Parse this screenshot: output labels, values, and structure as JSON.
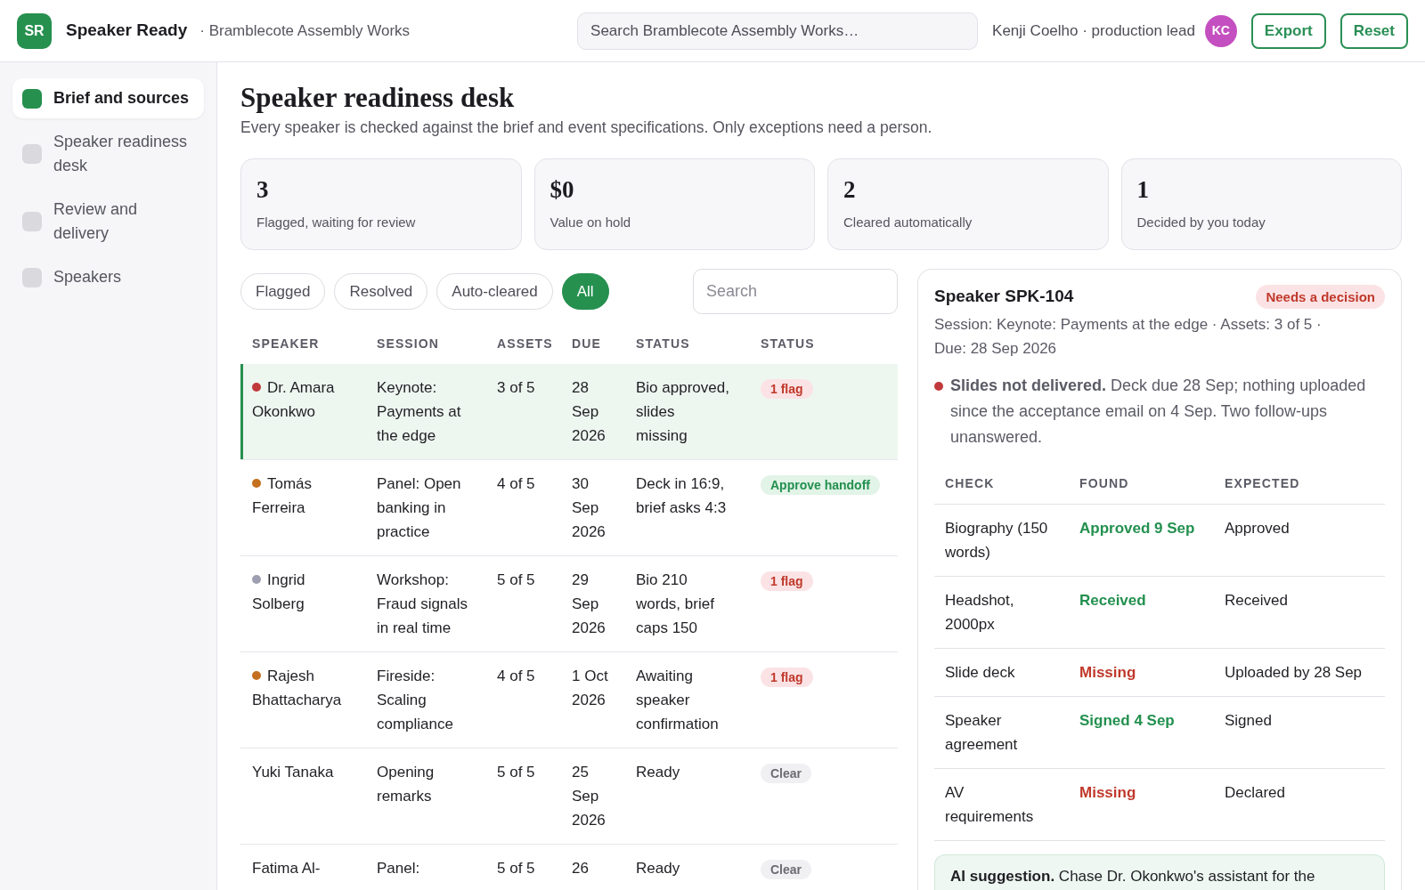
{
  "header": {
    "logo": "SR",
    "app_name": "Speaker Ready",
    "workspace": "· Bramblecote Assembly Works",
    "search": {
      "placeholder": "Search Bramblecote Assembly Works…"
    },
    "user": "Kenji Coelho · production lead",
    "avatar": "KC",
    "buttons": [
      "Export",
      "Reset"
    ]
  },
  "sidebar": {
    "items": [
      {
        "label": "Brief and sources",
        "selected": true
      },
      {
        "label": "Speaker readiness desk",
        "selected": false
      },
      {
        "label": "Review and delivery",
        "selected": false
      },
      {
        "label": "Speakers",
        "selected": false
      }
    ]
  },
  "page": {
    "title": "Speaker readiness desk",
    "subtitle": "Every speaker is checked against the brief and event specifications. Only exceptions need a person."
  },
  "stats": [
    {
      "value": "3",
      "label": "Flagged, waiting for review"
    },
    {
      "value": "$0",
      "label": "Value on hold"
    },
    {
      "value": "2",
      "label": "Cleared automatically"
    },
    {
      "value": "1",
      "label": "Decided by you today"
    }
  ],
  "filters": {
    "chips": [
      {
        "label": "Flagged",
        "selected": false
      },
      {
        "label": "Resolved",
        "selected": false
      },
      {
        "label": "Auto-cleared",
        "selected": false
      },
      {
        "label": "All",
        "selected": true
      }
    ],
    "search": {
      "placeholder": "Search"
    }
  },
  "table": {
    "columns": [
      "SPEAKER",
      "SESSION",
      "ASSETS",
      "DUE",
      "STATUS",
      "STATUS"
    ],
    "rows": [
      {
        "speaker": "Dr. Amara Okonkwo",
        "color": "#c0393b",
        "session": "Keynote: Payments at the edge",
        "assets": "3 of 5",
        "due": "28 Sep 2026",
        "status": "Bio approved, slides missing",
        "badge": {
          "kind": "flag",
          "label": "1 flag"
        },
        "selected": true
      },
      {
        "speaker": "Tomás Ferreira",
        "color": "#c4701f",
        "session": "Panel: Open banking in practice",
        "assets": "4 of 5",
        "due": "30 Sep 2026",
        "status": "Deck in 16:9, brief asks 4:3",
        "badge": {
          "kind": "approve",
          "label": "Approve handoff"
        },
        "selected": false
      },
      {
        "speaker": "Ingrid Solberg",
        "color": "#9e9eb0",
        "session": "Workshop: Fraud signals in real time",
        "assets": "5 of 5",
        "due": "29 Sep 2026",
        "status": "Bio 210 words, brief caps 150",
        "badge": {
          "kind": "flag",
          "label": "1 flag"
        },
        "selected": false
      },
      {
        "speaker": "Rajesh Bhattacharya",
        "color": "#c4701f",
        "session": "Fireside: Scaling compliance",
        "assets": "4 of 5",
        "due": "1 Oct 2026",
        "status": "Awaiting speaker confirmation",
        "badge": {
          "kind": "flag",
          "label": "1 flag"
        },
        "selected": false
      },
      {
        "speaker": "Yuki Tanaka",
        "session": "Opening remarks",
        "assets": "5 of 5",
        "due": "25 Sep 2026",
        "status": "Ready",
        "badge": {
          "kind": "clear",
          "label": "Clear"
        },
        "selected": false
      },
      {
        "speaker": "Fatima Al-",
        "session": "Panel:",
        "assets": "5 of 5",
        "due": "26",
        "status": "Ready",
        "badge": {
          "kind": "clear",
          "label": "Clear"
        },
        "selected": false
      }
    ]
  },
  "detail": {
    "title": "Speaker SPK-104",
    "badge": "Needs a decision",
    "meta": "Session: Keynote: Payments at the edge · Assets: 3 of 5 · Due: 28 Sep 2026",
    "issue": "**Slides not delivered.** Deck due 28 Sep; nothing uploaded since the acceptance email on 4 Sep. Two follow-ups unanswered.",
    "checks": {
      "columns": [
        "CHECK",
        "FOUND",
        "EXPECTED"
      ],
      "rows": [
        {
          "check": "Biography (150 words)",
          "found": "Approved 9 Sep",
          "passed": true,
          "expected": "Approved"
        },
        {
          "check": "Headshot, 2000px",
          "found": "Received",
          "passed": true,
          "expected": "Received"
        },
        {
          "check": "Slide deck",
          "found": "Missing",
          "passed": false,
          "expected": "Uploaded by 28 Sep"
        },
        {
          "check": "Speaker agreement",
          "found": "Signed 4 Sep",
          "passed": true,
          "expected": "Signed"
        },
        {
          "check": "AV requirements",
          "found": "Missing",
          "passed": false,
          "expected": "Declared"
        }
      ]
    },
    "suggestion": "**AI suggestion.** Chase Dr. Okonkwo's assistant for the"
  }
}
